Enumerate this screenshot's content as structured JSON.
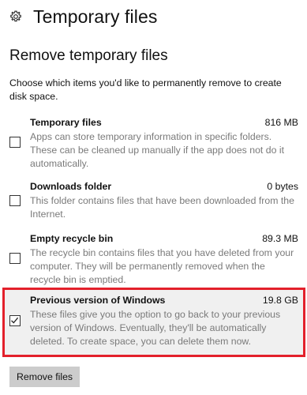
{
  "header": {
    "title": "Temporary files",
    "icon": "gear-icon"
  },
  "section_title": "Remove temporary files",
  "description": "Choose which items you'd like to permanently remove to create disk space.",
  "items": [
    {
      "name": "Temporary files",
      "size": "816 MB",
      "checked": false,
      "text": "Apps can store temporary information in specific folders. These can be cleaned up manually if the app does not do it automatically."
    },
    {
      "name": "Downloads folder",
      "size": "0 bytes",
      "checked": false,
      "text": "This folder contains files that have been downloaded from the Internet."
    },
    {
      "name": "Empty recycle bin",
      "size": "89.3 MB",
      "checked": false,
      "text": "The recycle bin contains files that you have deleted from your computer. They will be permanently removed when the recycle bin is emptied."
    },
    {
      "name": "Previous version of Windows",
      "size": "19.8 GB",
      "checked": true,
      "text": "These files give you the option to go back to your previous version of Windows. Eventually, they'll be automatically deleted. To create space, you can delete them now."
    }
  ],
  "remove_button_label": "Remove files",
  "highlight_color": "#e3202b"
}
